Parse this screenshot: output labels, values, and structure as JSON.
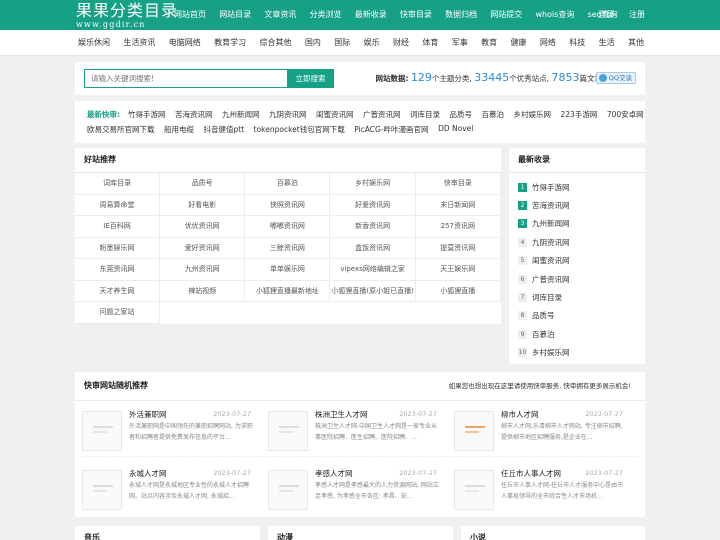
{
  "header": {
    "logo_cn": "果果分类目录",
    "logo_url": "www.ggdir.cn",
    "nav": [
      "网站首页",
      "网站目录",
      "文章资讯",
      "分类浏览",
      "最新收录",
      "快审目录",
      "数据归档",
      "网站提交",
      "whois查询",
      "seo查询"
    ],
    "login": "登录",
    "register": "注册"
  },
  "categories": [
    "娱乐休闲",
    "生活资讯",
    "电脑网络",
    "教育学习",
    "综合其他",
    "国内",
    "国际",
    "娱乐",
    "财经",
    "体育",
    "军事",
    "教育",
    "健康",
    "网络",
    "科技",
    "生活",
    "其他"
  ],
  "search": {
    "placeholder": "请输入关键词搜索!",
    "button": "立即搜索"
  },
  "stats": {
    "label": "网站数据:",
    "cats": "129",
    "cats_suffix": "个主题分类,",
    "sites": "33445",
    "sites_suffix": "个优秀站点,",
    "articles": "7853",
    "articles_suffix": "篇文章",
    "qq": "QQ交谈"
  },
  "quick": {
    "title": "最新快审:",
    "row1": [
      "竹得手游网",
      "苦海资讯网",
      "九州新闻网",
      "九阴资讯网",
      "闺蜜资讯网",
      "广普资讯网",
      "词库目录",
      "品质号",
      "百慕泊",
      "乡村娱乐网",
      "223手游网",
      "700安卓网"
    ],
    "row2": [
      "欧易交易所官网下载",
      "船用电缆",
      "抖音健值ptt",
      "tokenpocket钱包官网下载",
      "PicACG-哔咔漫画官网",
      "DD Novel"
    ]
  },
  "good": {
    "title": "好站推荐",
    "items": [
      "词库目录",
      "品质号",
      "百慕泊",
      "乡村娱乐网",
      "快审目录",
      "周易算命堂",
      "好看电影",
      "快照资讯网",
      "好爱资讯网",
      "末日新闻网",
      "IE百科网",
      "优优资讯网",
      "嘟嘟资讯网",
      "新香资讯网",
      "257资讯网",
      "粉墨娱乐网",
      "爱好资讯网",
      "三鲸资讯网",
      "盒饭资讯网",
      "提莫资讯网",
      "东莞资讯网",
      "九州资讯网",
      "单单娱乐网",
      "vipexs网络编辑之家",
      "天王娱乐网",
      "天才养生网",
      "辣站视频",
      "小狐狸直播最新地址",
      "小狐狸直播(原小姐已直播)",
      "小狐狸直播",
      "问题之家站"
    ]
  },
  "newest": {
    "title": "最新收录",
    "items": [
      {
        "n": "1",
        "name": "竹得手游网"
      },
      {
        "n": "2",
        "name": "苦海资讯网"
      },
      {
        "n": "3",
        "name": "九州新闻网"
      },
      {
        "n": "4",
        "name": "九阴资讯网"
      },
      {
        "n": "5",
        "name": "闺蜜资讯网"
      },
      {
        "n": "6",
        "name": "广普资讯网"
      },
      {
        "n": "7",
        "name": "词库目录"
      },
      {
        "n": "8",
        "name": "品质号"
      },
      {
        "n": "9",
        "name": "百慕泊"
      },
      {
        "n": "10",
        "name": "乡村娱乐网"
      }
    ]
  },
  "random": {
    "title": "快审网站随机推荐",
    "note": "如果您也想出现在这里请使用快审服务, 快审拥有更多展示机会!",
    "cards": [
      {
        "title": "外活兼职网",
        "date": "2023-07-27",
        "desc": "外活兼职网是中国领先的兼职招聘网站, 为求职者和招聘者提供免费发布信息的平台..."
      },
      {
        "title": "株洲卫生人才网",
        "date": "2023-07-27",
        "desc": "株洲卫生人才网-中国卫生人才网是一家专业从事医院招聘、医生招聘、医院招聘、..."
      },
      {
        "title": "柳市人才网",
        "date": "2023-07-27",
        "desc": "柳市人才网,乐清柳市人才网站, 专注柳市招聘, 提供柳市地区招聘服务,是企业在..."
      },
      {
        "title": "永城人才网",
        "date": "2023-07-27",
        "desc": "永城人才网是永城地区专业性的永城人才招聘网。站点内容涉及永城人才网, 永城招..."
      },
      {
        "title": "孝感人才网",
        "date": "2023-07-27",
        "desc": "孝感人才网是孝感最大的人力资源网站, 网站立足孝感, 为孝感全市各区: 孝昌、安..."
      },
      {
        "title": "任丘市人事人才网",
        "date": "2023-07-27",
        "desc": "任丘市人事人才网-任丘市人才服务中心是由市人事局领导的全市综合性人才市场机..."
      }
    ]
  },
  "bottom": [
    "音乐",
    "动漫",
    "小说"
  ]
}
